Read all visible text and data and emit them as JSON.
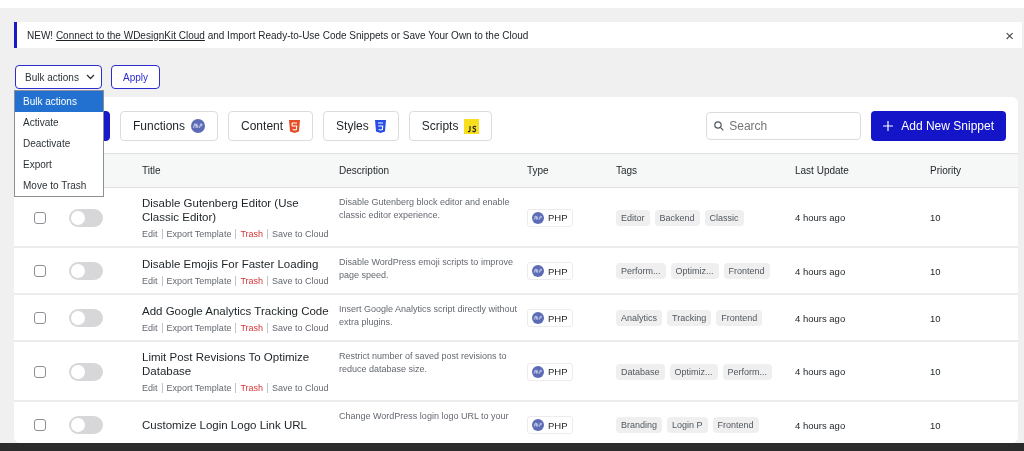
{
  "notice": {
    "prefix": "NEW!",
    "link": "Connect to the WDesignKit Cloud",
    "text": "and Import Ready-to-Use Code Snippets or Save Your Own to the Cloud",
    "close": "×"
  },
  "bulk": {
    "value": "Bulk actions",
    "apply": "Apply",
    "options": [
      {
        "label": "Bulk actions",
        "selected": true
      },
      {
        "label": "Activate",
        "selected": false
      },
      {
        "label": "Deactivate",
        "selected": false
      },
      {
        "label": "Export",
        "selected": false
      },
      {
        "label": "Move to Trash",
        "selected": false
      }
    ]
  },
  "filters": [
    {
      "kind": "all",
      "selected": true
    },
    {
      "label": "Functions",
      "kind": "php",
      "selected": false
    },
    {
      "label": "Content",
      "kind": "html",
      "selected": false
    },
    {
      "label": "Styles",
      "kind": "css",
      "selected": false
    },
    {
      "label": "Scripts",
      "kind": "js",
      "selected": false
    }
  ],
  "search": {
    "placeholder": "Search"
  },
  "add_button": "Add New Snippet",
  "table": {
    "columns": [
      "Title",
      "Description",
      "Type",
      "Tags",
      "Last Update",
      "Priority"
    ],
    "rows": [
      {
        "checked": false,
        "on": false,
        "title": "Disable Gutenberg Editor (Use Classic Editor)",
        "actions": [
          {
            "label": "Edit",
            "kind": "link"
          },
          {
            "label": "Export Template",
            "kind": "link"
          },
          {
            "label": "Trash",
            "kind": "danger"
          },
          {
            "label": "Save to Cloud",
            "kind": "link"
          }
        ],
        "description": "Disable Gutenberg block editor and enable classic editor experience.",
        "type": "PHP",
        "tags": [
          "Editor",
          "Backend",
          "Classic"
        ],
        "updated": "4 hours ago",
        "priority": "10"
      },
      {
        "checked": false,
        "on": false,
        "title": "Disable Emojis For Faster Loading",
        "actions": [
          {
            "label": "Edit",
            "kind": "link"
          },
          {
            "label": "Export Template",
            "kind": "link"
          },
          {
            "label": "Trash",
            "kind": "danger"
          },
          {
            "label": "Save to Cloud",
            "kind": "link"
          }
        ],
        "description": "Disable WordPress emoji scripts to improve page speed.",
        "type": "PHP",
        "tags": [
          "Perform...",
          "Optimiz...",
          "Frontend"
        ],
        "updated": "4 hours ago",
        "priority": "10"
      },
      {
        "checked": false,
        "on": false,
        "title": "Add Google Analytics Tracking Code",
        "actions": [
          {
            "label": "Edit",
            "kind": "link"
          },
          {
            "label": "Export Template",
            "kind": "link"
          },
          {
            "label": "Trash",
            "kind": "danger"
          },
          {
            "label": "Save to Cloud",
            "kind": "link"
          }
        ],
        "description": "Insert Google Analytics script directly without extra plugins.",
        "type": "PHP",
        "tags": [
          "Analytics",
          "Tracking",
          "Frontend"
        ],
        "updated": "4 hours ago",
        "priority": "10"
      },
      {
        "checked": false,
        "on": false,
        "title": "Limit Post Revisions To Optimize Database",
        "actions": [
          {
            "label": "Edit",
            "kind": "link"
          },
          {
            "label": "Export Template",
            "kind": "link"
          },
          {
            "label": "Trash",
            "kind": "danger"
          },
          {
            "label": "Save to Cloud",
            "kind": "link"
          }
        ],
        "description": "Restrict number of saved post revisions to reduce database size.",
        "type": "PHP",
        "tags": [
          "Database",
          "Optimiz...",
          "Perform..."
        ],
        "updated": "4 hours ago",
        "priority": "10"
      },
      {
        "checked": false,
        "on": false,
        "title": "Customize Login Logo Link URL",
        "description": "Change WordPress login logo URL to your",
        "type": "PHP",
        "tags": [
          "Branding",
          "Login P",
          "Frontend"
        ],
        "updated": "4 hours ago",
        "priority": "10"
      }
    ]
  }
}
